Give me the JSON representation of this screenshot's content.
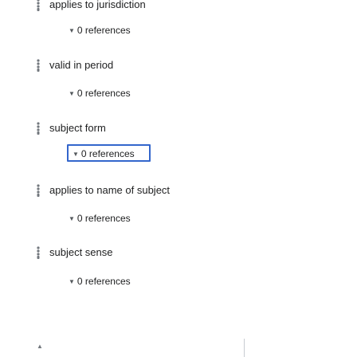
{
  "statements": [
    {
      "label": "applies to jurisdiction",
      "refs": "0 references",
      "partial_top": true
    },
    {
      "label": "valid in period",
      "refs": "0 references"
    },
    {
      "label": "subject form",
      "refs": "0 references",
      "focused": true
    },
    {
      "label": "applies to name of subject",
      "refs": "0 references"
    },
    {
      "label": "subject sense",
      "refs": "0 references"
    }
  ],
  "icons": {
    "handle": "drag-handle-icon",
    "caret": "caret-down-icon",
    "bottom": "caret-up-icon"
  },
  "colors": {
    "focus_border": "#3366cc",
    "text": "#202122",
    "icon": "#72777d"
  }
}
